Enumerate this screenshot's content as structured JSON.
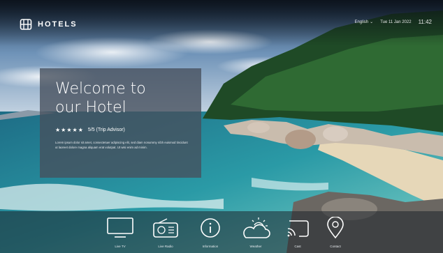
{
  "brand": {
    "name": "HOTELS"
  },
  "status": {
    "language": "English",
    "date": "Tue 11 Jan 2022",
    "time": "11:42"
  },
  "welcome": {
    "title_line1": "Welcome to",
    "title_line2": "our Hotel",
    "stars": "★★★★★",
    "star_rating": 5,
    "rating_text": "5/5 (Trip Advisor)",
    "description": "Lorem ipsum dolor sit amet, consectetuer adipiscing elit, sed diam nonummy nibh euismod tincidunt ut laoreet dolore magna aliquam erat volutpat. Ut wisi enim ad minim."
  },
  "dock": {
    "items": [
      {
        "label": "Live TV",
        "icon": "tv-icon"
      },
      {
        "label": "Live Radio",
        "icon": "radio-icon"
      },
      {
        "label": "Information",
        "icon": "info-icon"
      },
      {
        "label": "Weather",
        "icon": "weather-icon"
      },
      {
        "label": "Cast",
        "icon": "cast-icon"
      },
      {
        "label": "Contact",
        "icon": "location-pin-icon"
      }
    ]
  }
}
